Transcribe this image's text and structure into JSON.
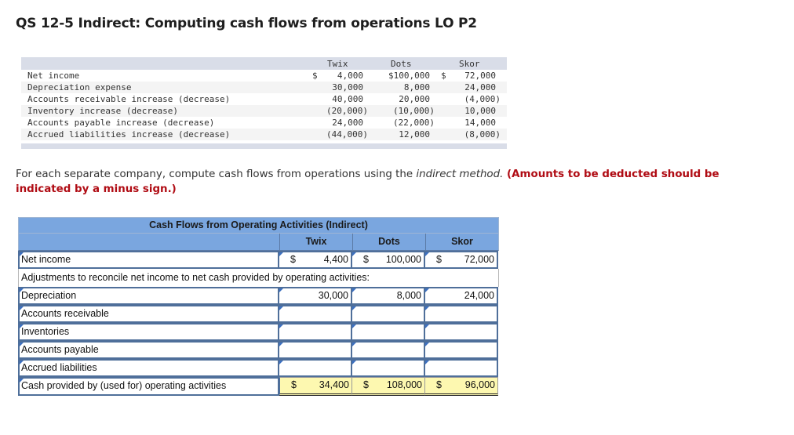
{
  "title": "QS 12-5 Indirect: Computing cash flows from operations LO P2",
  "given_table": {
    "columns": [
      "Twix",
      "Dots",
      "Skor"
    ],
    "rows": [
      {
        "label": "Net income",
        "values": [
          "4,000",
          "$100,000",
          "72,000"
        ],
        "dollar_twix": "$",
        "dollar_skor": "$"
      },
      {
        "label": "Depreciation expense",
        "values": [
          "30,000",
          "8,000",
          "24,000"
        ]
      },
      {
        "label": "Accounts receivable increase (decrease)",
        "values": [
          "40,000",
          "20,000",
          "(4,000)"
        ]
      },
      {
        "label": "Inventory increase (decrease)",
        "values": [
          "(20,000)",
          "(10,000)",
          "10,000"
        ]
      },
      {
        "label": "Accounts payable increase (decrease)",
        "values": [
          "24,000",
          "(22,000)",
          "14,000"
        ]
      },
      {
        "label": "Accrued liabilities increase (decrease)",
        "values": [
          "(44,000)",
          "12,000",
          "(8,000)"
        ]
      }
    ]
  },
  "instructions": {
    "text_before": "For each separate company, compute cash flows from operations using the ",
    "italic": "indirect method.",
    "bold_red": " (Amounts to be deducted should be indicated by a minus sign.)"
  },
  "answer_table": {
    "heading": "Cash Flows from Operating Activities (Indirect)",
    "columns": [
      "Twix",
      "Dots",
      "Skor"
    ],
    "currency": "$",
    "net_income": {
      "label": "Net income",
      "values": [
        "4,400",
        "100,000",
        "72,000"
      ]
    },
    "adjustments_label": "Adjustments to reconcile net income to net cash provided by operating activities:",
    "rows": [
      {
        "label": "Depreciation",
        "values": [
          "30,000",
          "8,000",
          "24,000"
        ]
      },
      {
        "label": "Accounts receivable",
        "values": [
          "",
          "",
          ""
        ]
      },
      {
        "label": "Inventories",
        "values": [
          "",
          "",
          ""
        ]
      },
      {
        "label": "Accounts payable",
        "values": [
          "",
          "",
          ""
        ]
      },
      {
        "label": "Accrued liabilities",
        "values": [
          "",
          "",
          ""
        ]
      }
    ],
    "total": {
      "label": "Cash provided by (used for) operating activities",
      "values": [
        "34,400",
        "108,000",
        "96,000"
      ]
    }
  }
}
